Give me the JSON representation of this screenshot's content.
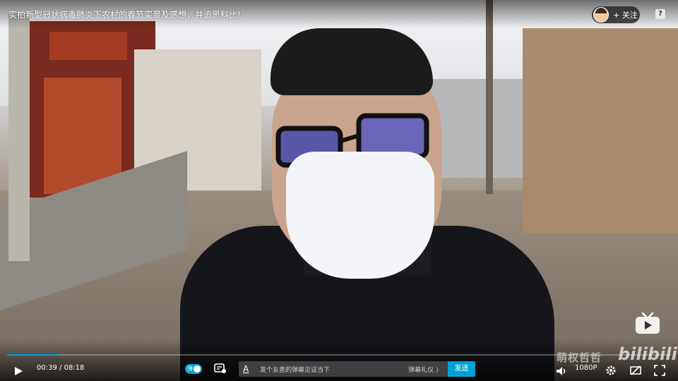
{
  "video": {
    "title": "实拍新型冠状病毒肺炎下农村的春节实景及感想，并追思科比!"
  },
  "uploader": {
    "follow_label": "+ 关注"
  },
  "top_right": {
    "help_icon": "?"
  },
  "player": {
    "current_time": "00:39",
    "duration": "08:18",
    "time_separator": "/",
    "progress": 0.078,
    "danmaku_toggle_label": "弹",
    "danmaku_placeholder": "发个友善的弹幕见证当下",
    "danmaku_etiquette": "弹幕礼仪 〉",
    "send_label": "发送",
    "quality": "1080P"
  },
  "overlay": {
    "watermark": "萌权哲哲",
    "logo": "bilibili"
  },
  "icons": {
    "play": "play-icon",
    "danmaku_settings": "danmaku-settings-icon",
    "volume": "volume-icon",
    "settings": "gear-icon",
    "widescreen": "widescreen-icon",
    "fullscreen": "fullscreen-icon",
    "tv": "tv-icon"
  },
  "colors": {
    "accent": "#00a1d6"
  }
}
